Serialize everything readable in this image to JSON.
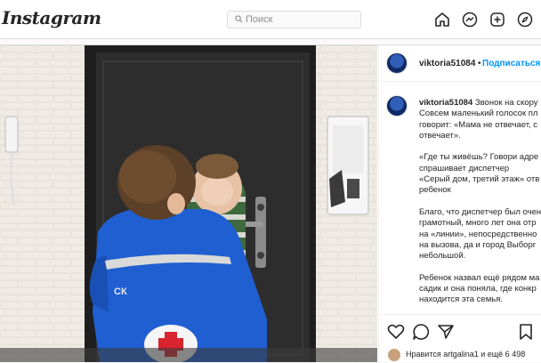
{
  "header": {
    "logo": "Instagram",
    "search_placeholder": "Поиск"
  },
  "nav": [
    "home-icon",
    "messenger-icon",
    "new-post-icon",
    "explore-icon"
  ],
  "post": {
    "username": "viktoria51084",
    "separator": "•",
    "follow_label": "Подписаться",
    "caption_user": "viktoria51084",
    "caption_lines": [
      "Звонок на скору",
      "Совсем маленький голосок пл",
      "говорит: «Мама не отвечает, с",
      "отвечает».",
      "",
      "«Где ты живёшь? Говори адре",
      "спрашивает диспетчер",
      "«Серый дом, третий этаж» отв",
      "ребенок",
      "",
      "Благо, что диспетчер был очен",
      "грамотный, много лет она отр",
      "на «линии», непосредственно",
      "на вызова, да и город Выборг",
      "небольшой.",
      "",
      "Ребенок назвал ещё рядом ма",
      "садик и она поняла, где конкр",
      "находится эта семья."
    ],
    "likes_text": "Нравится artgalina1 и ещё 6 498"
  },
  "colors": {
    "accent": "#0095f6",
    "jacket": "#1f5fd1",
    "door": "#2b2b2b"
  }
}
